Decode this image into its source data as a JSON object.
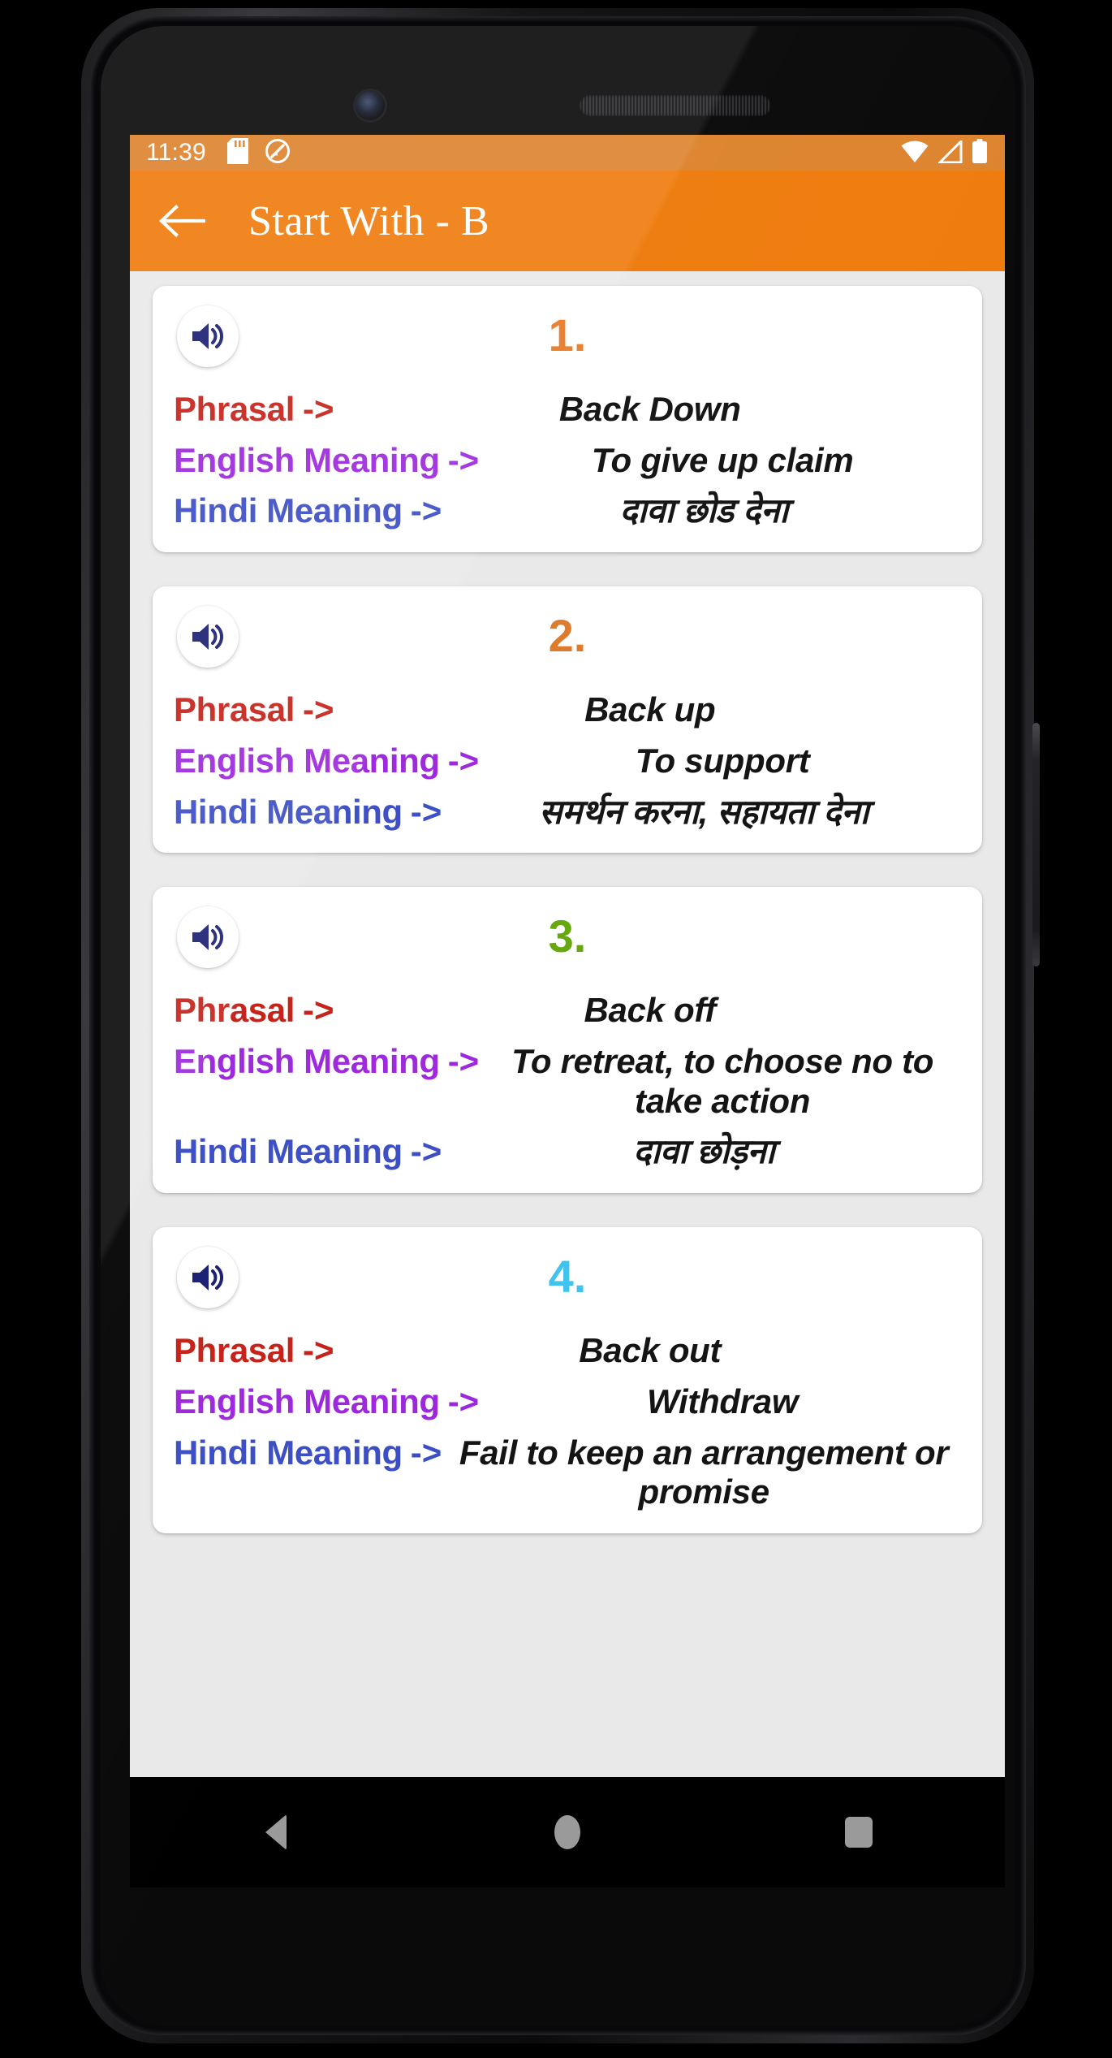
{
  "statusbar": {
    "time": "11:39",
    "icons_left": [
      "sdcard-icon",
      "do-not-disturb-icon"
    ],
    "icons_right": [
      "wifi-icon",
      "signal-icon",
      "battery-icon"
    ],
    "background_color": "#dd842f"
  },
  "appbar": {
    "title": "Start With - B",
    "back_icon": "back-arrow-icon",
    "background_color": "#ef7c0e",
    "text_color": "#ffffff"
  },
  "labels": {
    "phrasal": "Phrasal",
    "english": "English Meaning",
    "hindi": "Hindi Meaning",
    "arrow": "->"
  },
  "colors": {
    "phrasal_label": "#c52118",
    "english_label": "#9d27dd",
    "hindi_label": "#3b4ec4",
    "value_text": "#141414",
    "app_background": "#e9e9e9",
    "card_background": "#ffffff",
    "speaker_icon": "#1b1f73"
  },
  "cards": [
    {
      "number": "1.",
      "number_color": "#e8761e",
      "speaker_icon": "speaker-icon",
      "phrasal": "Back Down",
      "english": "To give up claim",
      "hindi": "दावा छोड देना"
    },
    {
      "number": "2.",
      "number_color": "#dd7a2a",
      "speaker_icon": "speaker-icon",
      "phrasal": "Back up",
      "english": "To support",
      "hindi": "समर्थन करना, सहायता देना"
    },
    {
      "number": "3.",
      "number_color": "#66a80c",
      "speaker_icon": "speaker-icon",
      "phrasal": "Back off",
      "english": "To retreat, to choose no to take action",
      "hindi": "दावा छोड़ना"
    },
    {
      "number": "4.",
      "number_color": "#41c3ef",
      "speaker_icon": "speaker-icon",
      "phrasal": "Back out",
      "english": "Withdraw",
      "hindi": "Fail to keep an arrangement or promise"
    }
  ],
  "navbar": {
    "back": "back-nav-icon",
    "home": "home-nav-icon",
    "recents": "recents-nav-icon"
  }
}
